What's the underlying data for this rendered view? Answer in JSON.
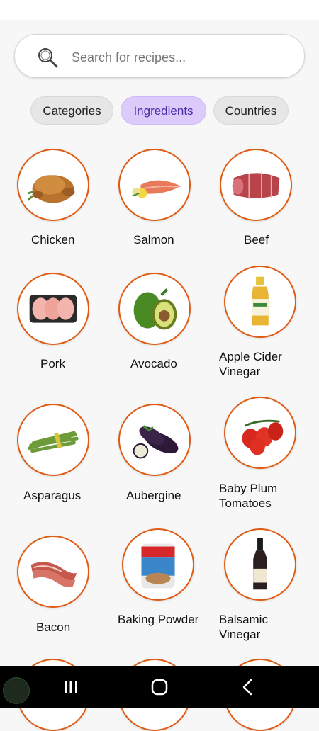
{
  "search": {
    "placeholder": "Search for recipes..."
  },
  "tabs": [
    {
      "label": "Categories"
    },
    {
      "label": "Ingredients"
    },
    {
      "label": "Countries"
    }
  ],
  "ingredients": [
    {
      "name": "Chicken"
    },
    {
      "name": "Salmon"
    },
    {
      "name": "Beef"
    },
    {
      "name": "Pork"
    },
    {
      "name": "Avocado"
    },
    {
      "name": "Apple Cider Vinegar"
    },
    {
      "name": "Asparagus"
    },
    {
      "name": "Aubergine"
    },
    {
      "name": "Baby Plum Tomatoes"
    },
    {
      "name": "Bacon"
    },
    {
      "name": "Baking Powder"
    },
    {
      "name": "Balsamic Vinegar"
    }
  ],
  "colors": {
    "accent_border": "#e05a12",
    "active_chip": "#dccafb",
    "active_chip_text": "#4b2ba8"
  }
}
